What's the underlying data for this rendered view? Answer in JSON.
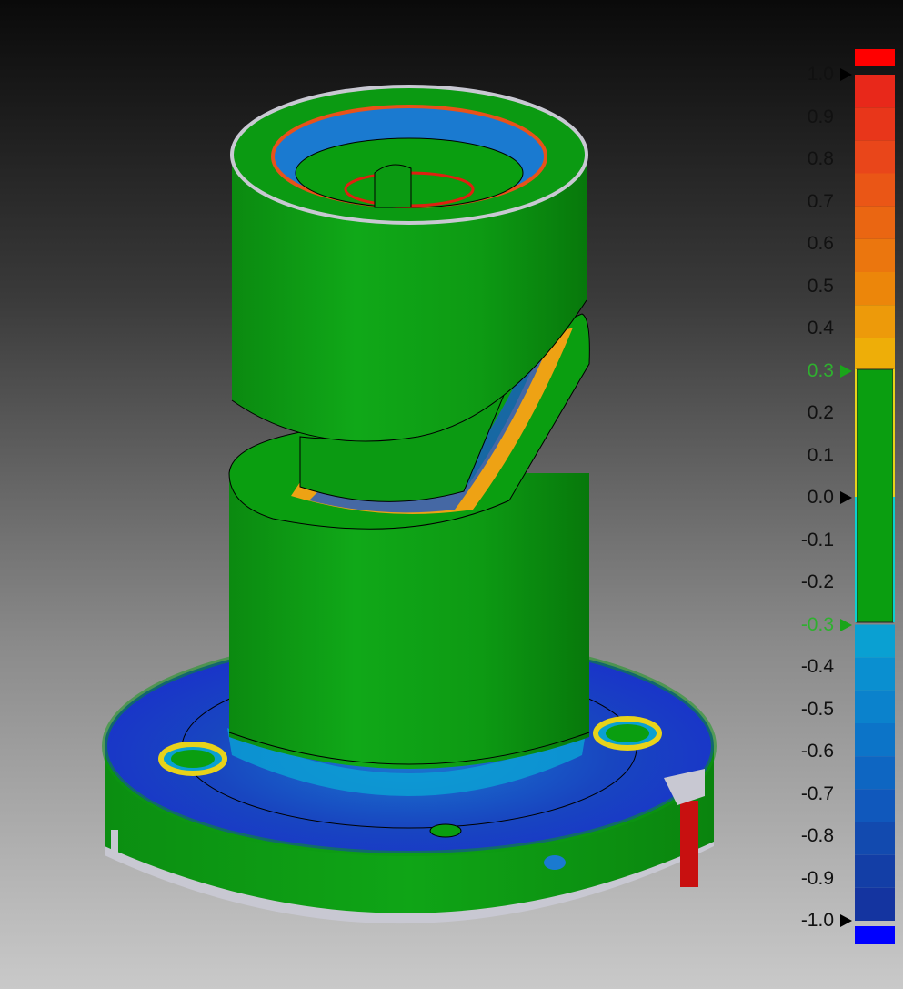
{
  "colors": {
    "nominal": "#0a9e10",
    "over_max": "#ff0000",
    "under_min": "#0000ff",
    "tolerance_label": "#2fb02f",
    "no_data": "#c8c8d2"
  },
  "legend": {
    "labels": [
      {
        "value": "1.0",
        "tolerance": false
      },
      {
        "value": "0.9",
        "tolerance": false
      },
      {
        "value": "0.8",
        "tolerance": false
      },
      {
        "value": "0.7",
        "tolerance": false
      },
      {
        "value": "0.6",
        "tolerance": false
      },
      {
        "value": "0.5",
        "tolerance": false
      },
      {
        "value": "0.4",
        "tolerance": false
      },
      {
        "value": "0.3",
        "tolerance": true
      },
      {
        "value": "0.2",
        "tolerance": false
      },
      {
        "value": "0.1",
        "tolerance": false
      },
      {
        "value": "0.0",
        "tolerance": false
      },
      {
        "value": "-0.1",
        "tolerance": false
      },
      {
        "value": "-0.2",
        "tolerance": false
      },
      {
        "value": "-0.3",
        "tolerance": true
      },
      {
        "value": "-0.4",
        "tolerance": false
      },
      {
        "value": "-0.5",
        "tolerance": false
      },
      {
        "value": "-0.6",
        "tolerance": false
      },
      {
        "value": "-0.7",
        "tolerance": false
      },
      {
        "value": "-0.8",
        "tolerance": false
      },
      {
        "value": "-0.9",
        "tolerance": false
      },
      {
        "value": "-1.0",
        "tolerance": false
      }
    ],
    "markers": [
      "1.0",
      "0.3",
      "0.0",
      "-0.3",
      "-1.0"
    ],
    "range": [
      -1.0,
      1.0
    ],
    "tolerance_range": [
      -0.3,
      0.3
    ],
    "upper_bands": [
      "#e8281a",
      "#e8361a",
      "#e9461a",
      "#ea5616",
      "#ea6612",
      "#eb760e",
      "#ec860a",
      "#ed9a0a",
      "#eeae08"
    ],
    "lower_bands": [
      "#0aa0d2",
      "#0a8fd0",
      "#0b82cc",
      "#0c74c8",
      "#0e66c2",
      "#1058bc",
      "#124aaf",
      "#133ea6",
      "#1434a0"
    ]
  }
}
